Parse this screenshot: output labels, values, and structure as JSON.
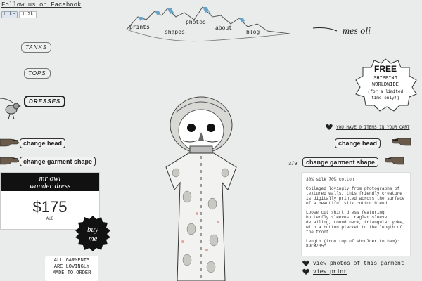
{
  "facebook": {
    "follow_label": "Follow us on Facebook",
    "like_label": "Like",
    "like_count": "1.2k"
  },
  "nav": {
    "items": [
      {
        "label": "prints"
      },
      {
        "label": "shapes"
      },
      {
        "label": "photos"
      },
      {
        "label": "about"
      },
      {
        "label": "blog"
      }
    ]
  },
  "logo": {
    "text": "mes oli"
  },
  "categories": {
    "items": [
      {
        "label": "TANKS"
      },
      {
        "label": "TOPS"
      },
      {
        "label": "DRESSES"
      }
    ],
    "active": "DRESSES"
  },
  "shipping": {
    "line1": "FREE",
    "line2": "SHIPPING",
    "line3": "WORLDWIDE",
    "line4": "(for a limited",
    "line5": "time only!)"
  },
  "cart": {
    "link_text": "YOU HAVE 0 ITEMS IN YOUR CART"
  },
  "controls": {
    "change_head_label": "change head",
    "change_garment_label": "change garment shape"
  },
  "gallery": {
    "counter": "3/9"
  },
  "product": {
    "name_line1": "mr owl",
    "name_line2": "wander dress",
    "price": "$175",
    "currency": "AUD",
    "buy_label_line1": "buy",
    "buy_label_line2": "me"
  },
  "notice": {
    "line1": "ALL GARMENTS",
    "line2": "ARE LOVINGLY",
    "line3": "MADE TO ORDER"
  },
  "description": {
    "material": "30% silk 70% cotton",
    "para1": "Collaged lovingly from photographs of textured walls, this friendly creature is digitally printed across the surface of a beautiful silk cotton blend.",
    "para2": "Loose cut shirt dress featuring butterfly sleeves, raglan sleeve detailing, round neck, triangular yoke, with a button placket to the length of the front.",
    "para3": "Length (from top of shoulder to hem): 89CM/35\""
  },
  "links": {
    "view_photos": "view photos of this garment",
    "view_print": "view print"
  },
  "colors": {
    "background": "#e9ecea",
    "ink": "#222222",
    "card_black": "#111111",
    "nav_accent_blue": "#6aa3c8"
  }
}
